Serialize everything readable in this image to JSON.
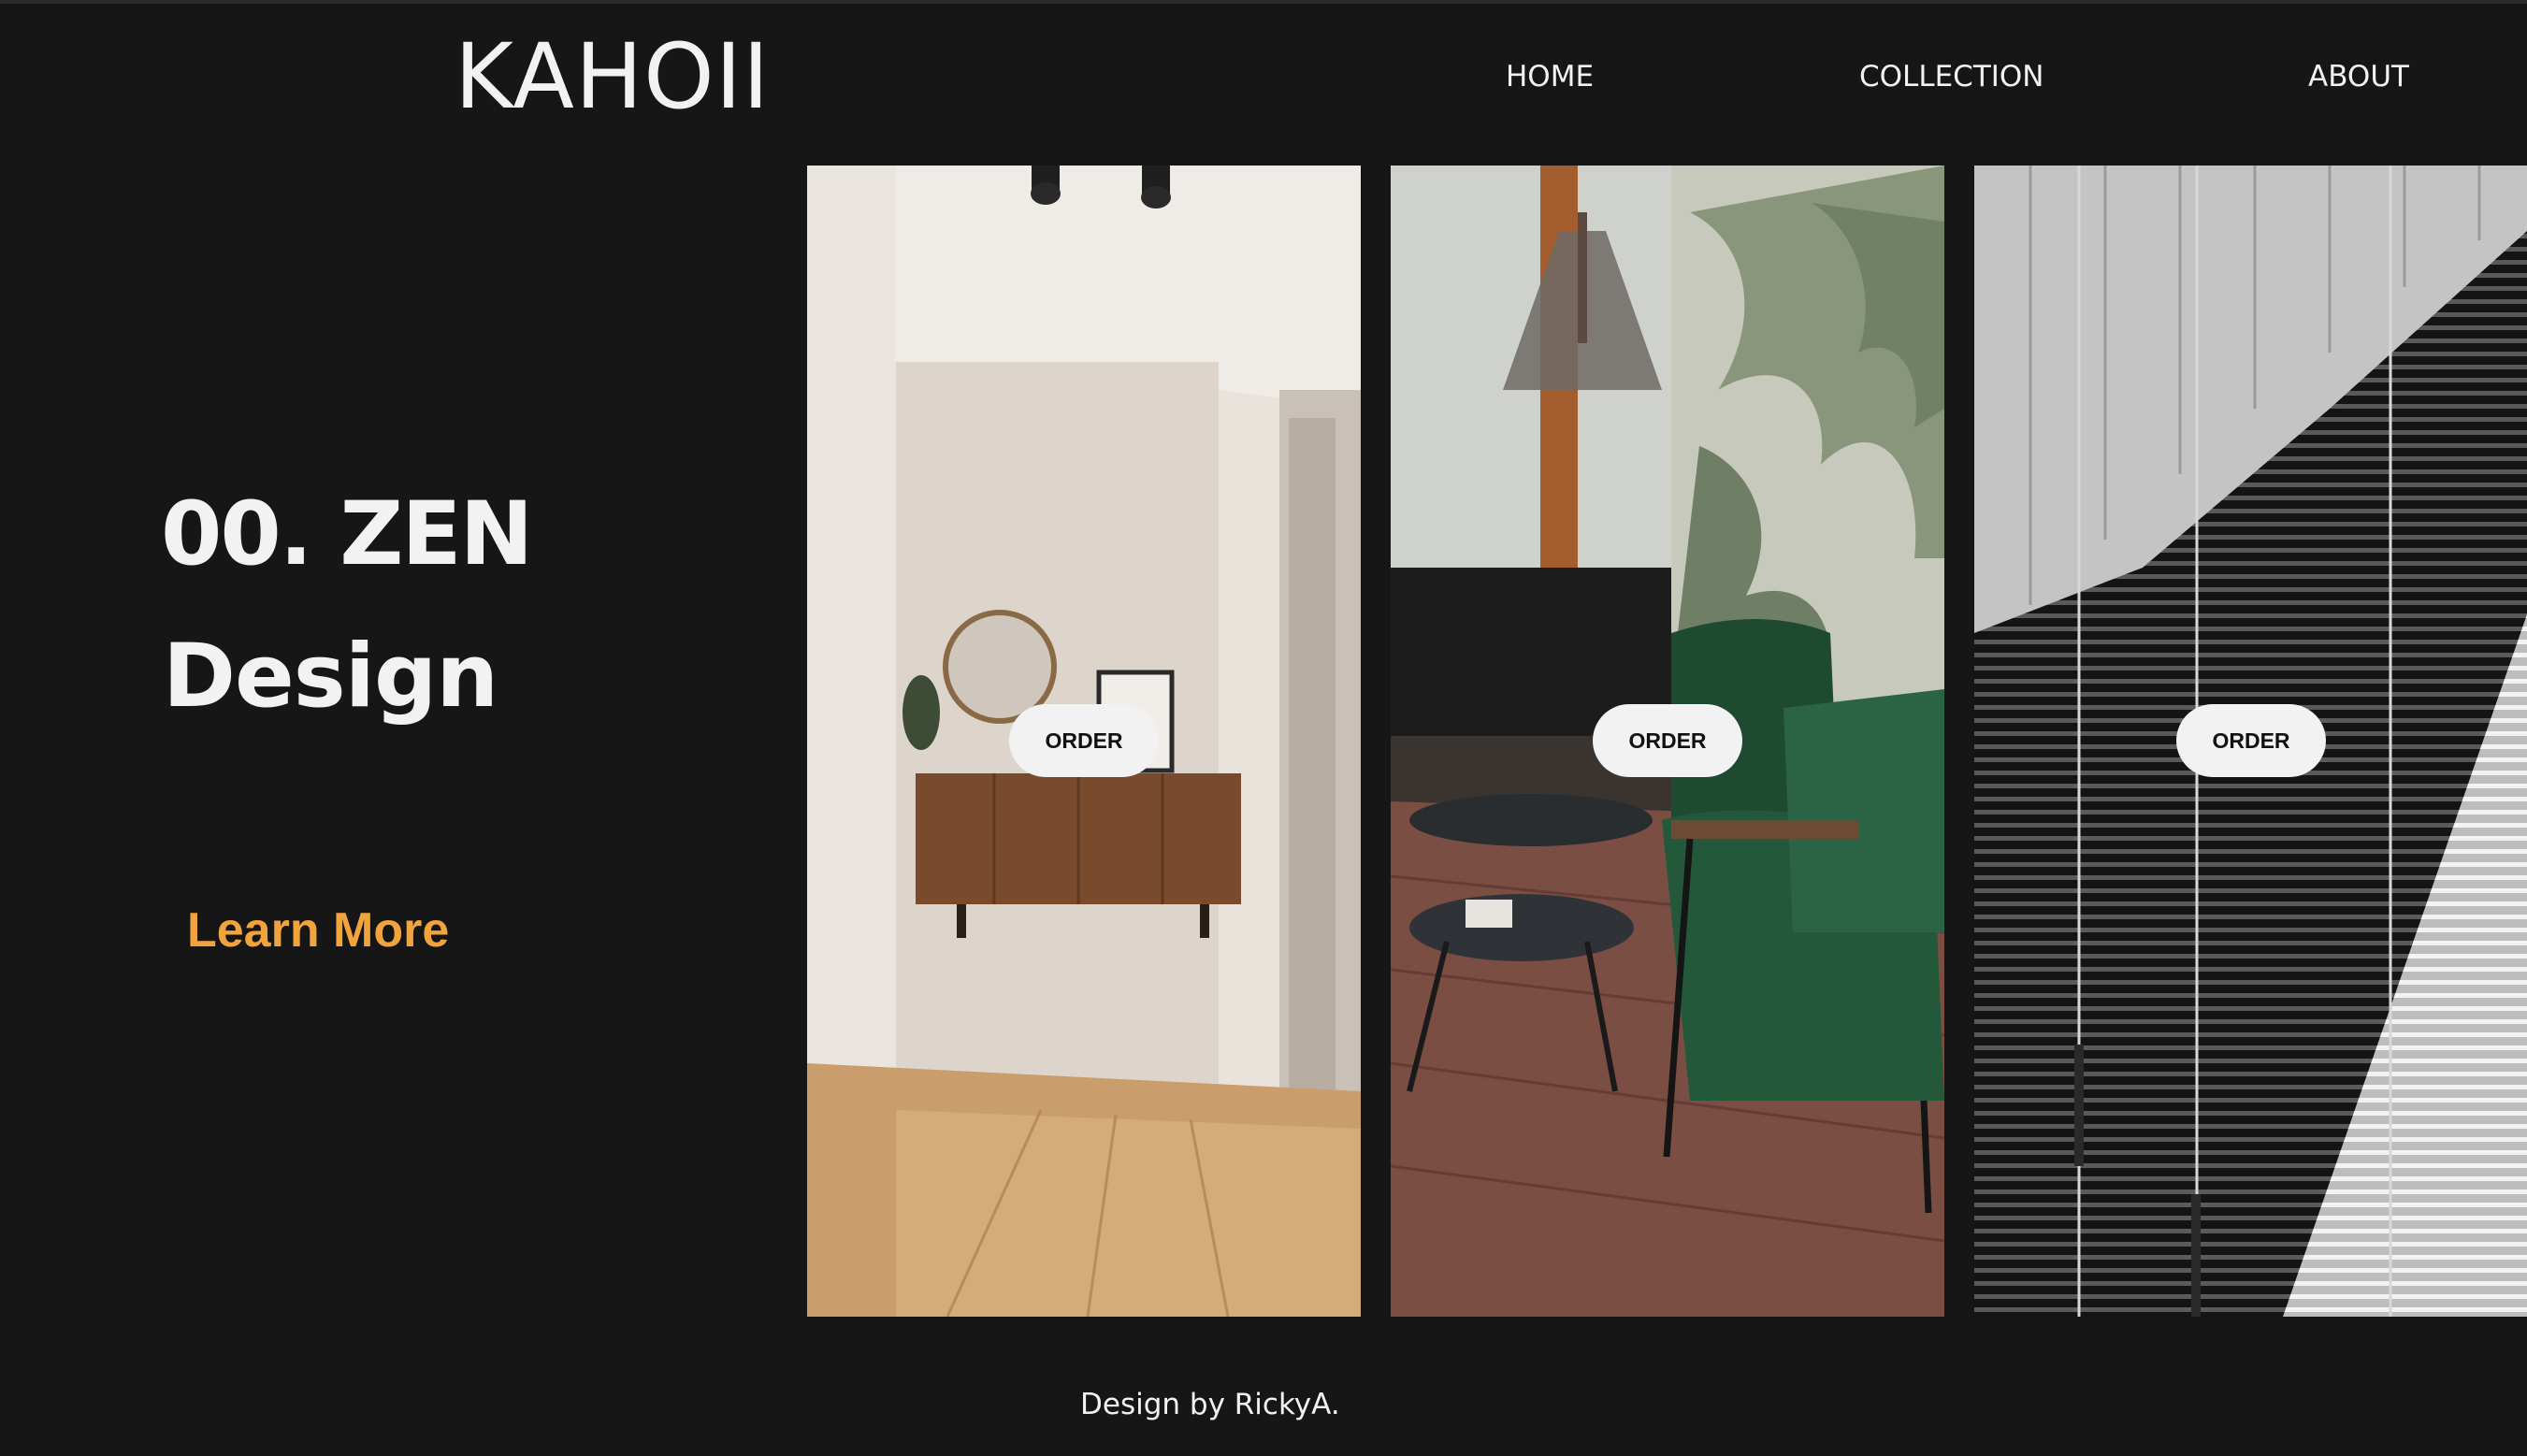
{
  "brand": {
    "logo": "KAHOII"
  },
  "nav": {
    "home": "HOME",
    "collection": "COLLECTION",
    "about": "ABOUT"
  },
  "hero": {
    "number_title": "00. ZEN",
    "subtitle": "Design",
    "cta": "Learn More"
  },
  "cards": [
    {
      "order_label": "ORDER"
    },
    {
      "order_label": "ORDER"
    },
    {
      "order_label": "ORDER"
    }
  ],
  "footer": {
    "credit": "Design by RickyA."
  },
  "colors": {
    "background": "#161616",
    "accent": "#f2a43c",
    "text": "#f2f2f2",
    "button_bg": "#f2f2f2"
  }
}
